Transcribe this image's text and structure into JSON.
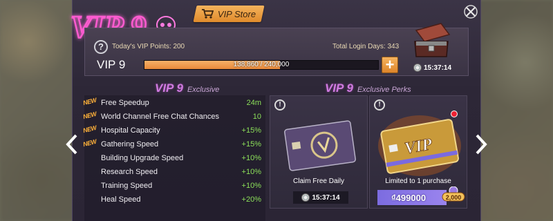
{
  "header": {
    "logo_text": "VIP 9",
    "store_label": "VIP Store"
  },
  "top": {
    "vip_points_label": "Today's VIP Points: 200",
    "login_days_label": "Total Login Days: 343",
    "vip_level": "VIP 9",
    "progress_text": "138,860 / 240,000",
    "progress_fraction": 0.5786,
    "chest_timer": "15:37:14"
  },
  "exclusive": {
    "title_big": "VIP 9",
    "title_small": "Exclusive",
    "new_tag": "NEW",
    "items": [
      {
        "name": "Free Speedup",
        "value": "24m",
        "is_new": true
      },
      {
        "name": "World Channel Free Chat Chances",
        "value": "10",
        "is_new": true
      },
      {
        "name": "Hospital Capacity",
        "value": "+15%",
        "is_new": true
      },
      {
        "name": "Gathering Speed",
        "value": "+15%",
        "is_new": true
      },
      {
        "name": "Building Upgrade Speed",
        "value": "+10%",
        "is_new": false
      },
      {
        "name": "Research Speed",
        "value": "+10%",
        "is_new": false
      },
      {
        "name": "Training Speed",
        "value": "+10%",
        "is_new": false
      },
      {
        "name": "Heal Speed",
        "value": "+20%",
        "is_new": false
      }
    ]
  },
  "perks": {
    "title_big": "VIP 9",
    "title_small": "Exclusive Perks",
    "free_card": {
      "caption": "Claim Free Daily",
      "timer": "15:37:14"
    },
    "paid_card": {
      "caption": "Limited to 1 purchase",
      "card_text": "VIP",
      "price": "₫499000",
      "bonus": "2,000"
    }
  },
  "colors": {
    "accent_orange": "#e8893b",
    "accent_purple": "#d07be0",
    "value_green": "#8ce05a"
  }
}
